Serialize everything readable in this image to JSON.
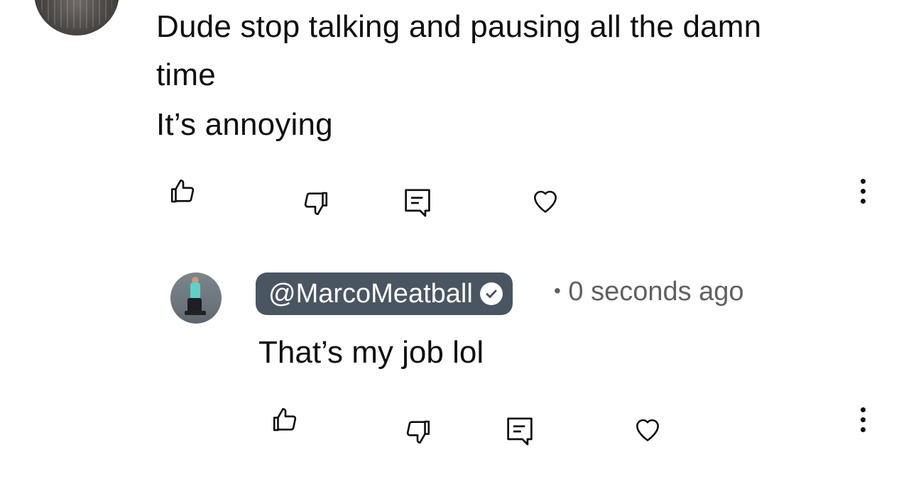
{
  "parent_comment": {
    "lines": [
      "Dude stop talking and pausing all the damn",
      "time",
      "It’s annoying"
    ],
    "actions": {
      "like_icon": "thumbs-up-icon",
      "dislike_icon": "thumbs-down-icon",
      "reply_icon": "comment-icon",
      "heart_icon": "heart-icon",
      "more_icon": "more-vertical-icon"
    }
  },
  "reply": {
    "author": "@MarcoMeatball",
    "verified": true,
    "separator": "•",
    "timestamp": "0 seconds ago",
    "text": "That’s my job lol",
    "actions": {
      "like_icon": "thumbs-up-icon",
      "dislike_icon": "thumbs-down-icon",
      "reply_icon": "comment-icon",
      "heart_icon": "heart-icon",
      "more_icon": "more-vertical-icon"
    }
  },
  "colors": {
    "author_chip_bg": "#4a5562",
    "text_primary": "#0f0f0f",
    "text_secondary": "#606060",
    "background": "#ffffff"
  }
}
